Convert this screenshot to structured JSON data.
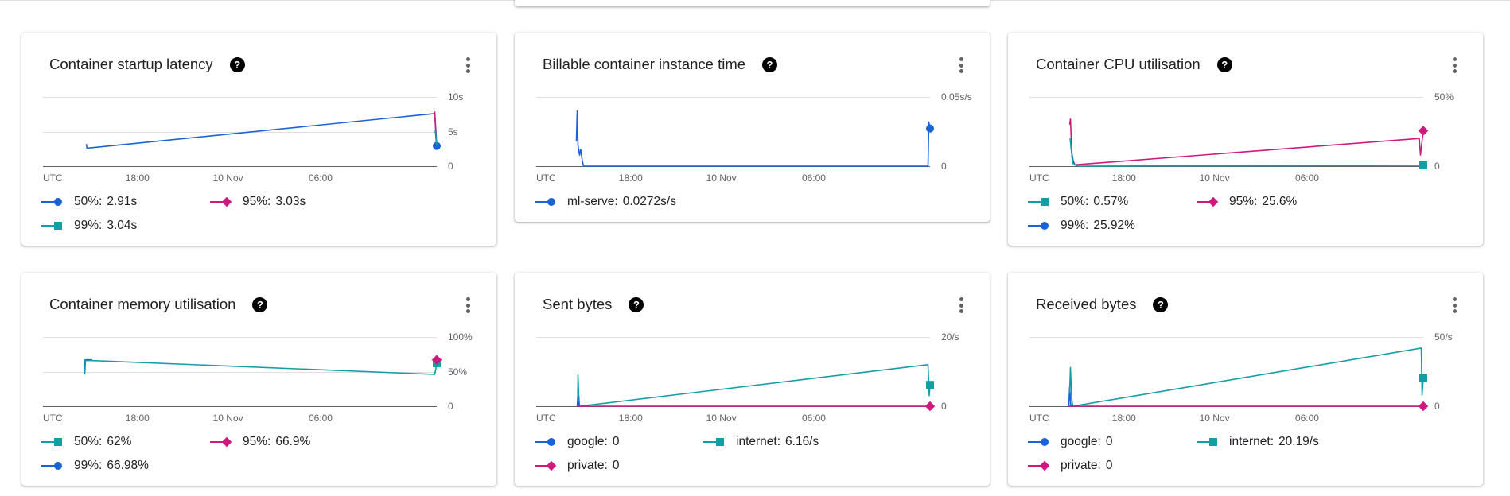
{
  "colors": {
    "blue": "#1a63d4",
    "pink": "#d0197e",
    "teal": "#119ea7",
    "grid": "#e0e0e0",
    "axis": "#616161"
  },
  "charts": [
    {
      "title": "Container startup latency",
      "x_ticks": [
        "UTC",
        "18:00",
        "10 Nov",
        "06:00"
      ],
      "y_ticks": [
        "10s",
        "5s",
        "0"
      ],
      "legend": [
        {
          "marker": "circle",
          "color": "#1a63d4",
          "label": "50%:",
          "value": "2.91s"
        },
        {
          "marker": "diamond",
          "color": "#d0197e",
          "label": "95%:",
          "value": "3.03s"
        },
        {
          "marker": "square",
          "color": "#119ea7",
          "label": "99%:",
          "value": "3.04s"
        }
      ]
    },
    {
      "title": "Billable container instance time",
      "x_ticks": [
        "UTC",
        "18:00",
        "10 Nov",
        "06:00"
      ],
      "y_ticks": [
        "0.05s/s",
        "0"
      ],
      "legend": [
        {
          "marker": "circle",
          "color": "#1a63d4",
          "label": "ml-serve:",
          "value": "0.0272s/s"
        }
      ]
    },
    {
      "title": "Container CPU utilisation",
      "x_ticks": [
        "UTC",
        "18:00",
        "10 Nov",
        "06:00"
      ],
      "y_ticks": [
        "50%",
        "0"
      ],
      "legend": [
        {
          "marker": "square",
          "color": "#119ea7",
          "label": "50%:",
          "value": "0.57%"
        },
        {
          "marker": "diamond",
          "color": "#d0197e",
          "label": "95%:",
          "value": "25.6%"
        },
        {
          "marker": "circle",
          "color": "#1a63d4",
          "label": "99%:",
          "value": "25.92%"
        }
      ]
    },
    {
      "title": "Container memory utilisation",
      "x_ticks": [
        "UTC",
        "18:00",
        "10 Nov",
        "06:00"
      ],
      "y_ticks": [
        "100%",
        "50%",
        "0"
      ],
      "legend": [
        {
          "marker": "square",
          "color": "#119ea7",
          "label": "50%:",
          "value": "62%"
        },
        {
          "marker": "diamond",
          "color": "#d0197e",
          "label": "95%:",
          "value": "66.9%"
        },
        {
          "marker": "circle",
          "color": "#1a63d4",
          "label": "99%:",
          "value": "66.98%"
        }
      ]
    },
    {
      "title": "Sent bytes",
      "x_ticks": [
        "UTC",
        "18:00",
        "10 Nov",
        "06:00"
      ],
      "y_ticks": [
        "20/s",
        "0"
      ],
      "legend": [
        {
          "marker": "circle",
          "color": "#1a63d4",
          "label": "google:",
          "value": "0"
        },
        {
          "marker": "square",
          "color": "#119ea7",
          "label": "internet:",
          "value": "6.16/s"
        },
        {
          "marker": "diamond",
          "color": "#d0197e",
          "label": "private:",
          "value": "0"
        }
      ]
    },
    {
      "title": "Received bytes",
      "x_ticks": [
        "UTC",
        "18:00",
        "10 Nov",
        "06:00"
      ],
      "y_ticks": [
        "50/s",
        "0"
      ],
      "legend": [
        {
          "marker": "circle",
          "color": "#1a63d4",
          "label": "google:",
          "value": "0"
        },
        {
          "marker": "square",
          "color": "#119ea7",
          "label": "internet:",
          "value": "20.19/s"
        },
        {
          "marker": "diamond",
          "color": "#d0197e",
          "label": "private:",
          "value": "0"
        }
      ]
    }
  ],
  "chart_data": [
    {
      "type": "line",
      "title": "Container startup latency",
      "ylim": [
        0,
        10
      ],
      "series": [
        {
          "name": "50%",
          "color": "#1a63d4",
          "points": [
            [
              0.11,
              3.2
            ],
            [
              0.112,
              2.6
            ],
            [
              0.995,
              7.6
            ],
            [
              0.998,
              5.0
            ],
            [
              1.0,
              2.91
            ]
          ],
          "marker": "circle"
        },
        {
          "name": "95%",
          "color": "#d0197e",
          "points": [
            [
              0.995,
              7.9
            ],
            [
              0.999,
              3.03
            ]
          ]
        },
        {
          "name": "99%",
          "color": "#119ea7",
          "points": [
            [
              0.996,
              5.2
            ],
            [
              1.0,
              3.04
            ]
          ]
        }
      ]
    },
    {
      "type": "line",
      "title": "Billable container instance time",
      "ylim": [
        0,
        0.05
      ],
      "series": [
        {
          "name": "ml-serve",
          "color": "#1a63d4",
          "points": [
            [
              0.102,
              0.018
            ],
            [
              0.104,
              0.04
            ],
            [
              0.106,
              0.015
            ],
            [
              0.11,
              0.008
            ],
            [
              0.113,
              0.012
            ],
            [
              0.117,
              0.004
            ],
            [
              0.12,
              0.0
            ],
            [
              0.995,
              0.0
            ],
            [
              0.997,
              0.032
            ],
            [
              1.0,
              0.0272
            ]
          ],
          "marker": "circle"
        }
      ]
    },
    {
      "type": "line",
      "title": "Container CPU utilisation",
      "ylim": [
        0,
        50
      ],
      "series": [
        {
          "name": "95%",
          "color": "#d0197e",
          "points": [
            [
              0.102,
              30
            ],
            [
              0.104,
              34
            ],
            [
              0.108,
              6
            ],
            [
              0.115,
              1
            ],
            [
              0.99,
              20
            ],
            [
              0.993,
              8
            ],
            [
              1.0,
              25.6
            ]
          ],
          "marker": "diamond"
        },
        {
          "name": "99%",
          "color": "#1a63d4",
          "points": [
            [
              0.105,
              14
            ],
            [
              0.112,
              2
            ],
            [
              0.12,
              0
            ]
          ]
        },
        {
          "name": "50%",
          "color": "#119ea7",
          "points": [
            [
              0.103,
              20
            ],
            [
              0.11,
              2
            ],
            [
              0.125,
              0
            ],
            [
              1.0,
              0.57
            ]
          ],
          "marker": "square"
        }
      ]
    },
    {
      "type": "line",
      "title": "Container memory utilisation",
      "ylim": [
        0,
        100
      ],
      "series": [
        {
          "name": "99%",
          "color": "#1a63d4",
          "points": [
            [
              0.105,
              48
            ],
            [
              0.107,
              67
            ],
            [
              0.125,
              67
            ]
          ]
        },
        {
          "name": "50%",
          "color": "#119ea7",
          "points": [
            [
              0.106,
              46
            ],
            [
              0.108,
              66
            ],
            [
              0.123,
              66
            ],
            [
              0.995,
              46
            ],
            [
              1.0,
              62
            ]
          ],
          "marker": "square"
        },
        {
          "name": "95%",
          "color": "#d0197e",
          "points": [
            [
              0.998,
              70
            ],
            [
              1.0,
              66.9
            ]
          ],
          "marker": "diamond"
        }
      ]
    },
    {
      "type": "line",
      "title": "Sent bytes",
      "ylim": [
        0,
        20
      ],
      "series": [
        {
          "name": "internet",
          "color": "#119ea7",
          "points": [
            [
              0.105,
              0
            ],
            [
              0.106,
              9
            ],
            [
              0.108,
              3
            ],
            [
              0.11,
              0
            ],
            [
              0.995,
              12
            ],
            [
              0.998,
              3
            ],
            [
              1.0,
              6.16
            ]
          ],
          "marker": "square"
        },
        {
          "name": "private",
          "color": "#d0197e",
          "points": [
            [
              0.105,
              0
            ],
            [
              0.13,
              0
            ],
            [
              0.99,
              0
            ],
            [
              1.0,
              0
            ]
          ],
          "marker": "diamond"
        },
        {
          "name": "google",
          "color": "#1a63d4",
          "points": [
            [
              0.104,
              0
            ],
            [
              0.106,
              3
            ],
            [
              0.108,
              0
            ]
          ]
        }
      ]
    },
    {
      "type": "line",
      "title": "Received bytes",
      "ylim": [
        0,
        50
      ],
      "series": [
        {
          "name": "google",
          "color": "#1a63d4",
          "points": [
            [
              0.1,
              0
            ],
            [
              0.102,
              14
            ],
            [
              0.105,
              0
            ]
          ]
        },
        {
          "name": "internet",
          "color": "#119ea7",
          "points": [
            [
              0.102,
              10
            ],
            [
              0.104,
              28
            ],
            [
              0.107,
              6
            ],
            [
              0.11,
              0
            ],
            [
              0.995,
              42
            ],
            [
              0.997,
              8
            ],
            [
              1.0,
              20.19
            ]
          ],
          "marker": "square"
        },
        {
          "name": "private",
          "color": "#d0197e",
          "points": [
            [
              0.1,
              0
            ],
            [
              0.13,
              0
            ],
            [
              0.99,
              0
            ],
            [
              1.0,
              0
            ]
          ],
          "marker": "diamond"
        }
      ]
    }
  ]
}
